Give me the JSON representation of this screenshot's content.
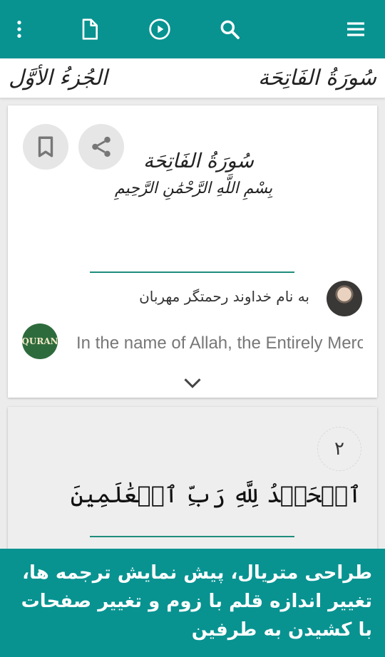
{
  "appbar": {
    "color": "#089391",
    "icons": [
      "more-vert-icon",
      "document-icon",
      "play-circle-icon",
      "search-icon",
      "menu-icon"
    ]
  },
  "juzbar": {
    "juz_name": "الجُزءُ الأوَّل",
    "surah_name": "سُورَةُ الفَاتِحَة"
  },
  "card1": {
    "surah_title": "سُورَةُ الفَاتِحَة",
    "basmala": "بِسْمِ اللَّهِ الرَّحْمَٰنِ الرَّحِيمِ",
    "persian_translation": "به نام خداوند رحمتگر مهربان",
    "english_translation": "In the name of Allah, the Entirely Merciful, the Especially Merciful."
  },
  "card2": {
    "ayah_number": "۲",
    "ayah_text": "ٱلۡحَمۡدُ لِلَّهِ رَبِّ ٱلۡعَٰلَمِينَ"
  },
  "banner": {
    "text": "طراحی متریال، پیش نمایش ترجمه ها، تغییر اندازه قلم با زوم و تغییر صفحات با کشیدن به طرفین"
  }
}
